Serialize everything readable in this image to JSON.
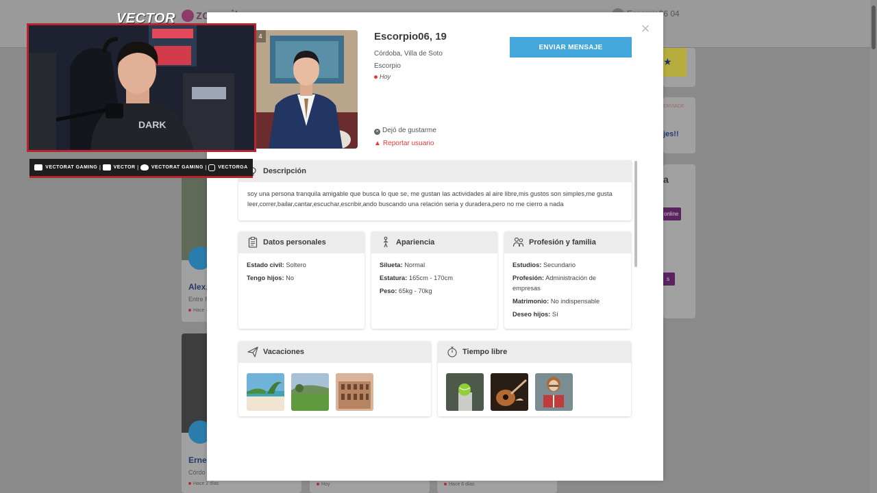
{
  "background": {
    "header_logo": "zonacitas",
    "user_label": "Escorpio06 04",
    "cards": [
      {
        "name": "Alex,",
        "location": "Entre R",
        "status": "Hace ·"
      },
      {
        "name": "Ernes",
        "location": "Córdo",
        "status": "Hace 2 días"
      }
    ],
    "bottom_statuses": [
      "Hoy",
      "Hace 6 días"
    ],
    "right_link": "jes!!",
    "right_small": "ENVIADE",
    "right_letter": "a",
    "online_label": "online",
    "s_label": "s"
  },
  "overlay": {
    "brand": "VECTOR",
    "social": [
      {
        "icon": "youtube-icon",
        "label": "VECTORAT GAMING"
      },
      {
        "icon": "twitch-icon",
        "label": "VECTOR"
      },
      {
        "icon": "twitter-icon",
        "label": "VECTORAT GAMING"
      },
      {
        "icon": "instagram-icon",
        "label": "VECTORGA"
      }
    ]
  },
  "profile": {
    "photo_count": "4",
    "name": "Escorpio06, 19",
    "location": "Córdoba, Villa de Soto",
    "sign": "Escorpio",
    "last_online": "Hoy",
    "send_message": "ENVIAR MENSAJE",
    "unlike": "Dejó de gustarme",
    "report": "Reportar usuario",
    "close_symbol": "×"
  },
  "description": {
    "title": "Descripción",
    "text": "soy una persona tranquila amigable que busca lo que se, me gustan las actividades al aire libre,mis gustos son simples,me gusta leer,correr,bailar,cantar,escuchar,escribir,ando buscando una relación seria y duradera,pero no me cierro a nada"
  },
  "personal": {
    "title": "Datos personales",
    "rows": [
      {
        "label": "Estado civil:",
        "value": "Soltero"
      },
      {
        "label": "Tengo hijos:",
        "value": "No"
      }
    ]
  },
  "appearance": {
    "title": "Apariencia",
    "rows": [
      {
        "label": "Silueta:",
        "value": "Normal"
      },
      {
        "label": "Estatura:",
        "value": "165cm - 170cm"
      },
      {
        "label": "Peso:",
        "value": "65kg - 70kg"
      }
    ]
  },
  "profession": {
    "title": "Profesión y familia",
    "rows": [
      {
        "label": "Estudios:",
        "value": "Secundario"
      },
      {
        "label": "Profesión:",
        "value": "Administración de empresas"
      },
      {
        "label": "Matrimonio:",
        "value": "No indispensable"
      },
      {
        "label": "Deseo hijos:",
        "value": "Sí"
      }
    ]
  },
  "vacations": {
    "title": "Vacaciones",
    "images": [
      "beach-photo",
      "countryside-photo",
      "colosseum-photo"
    ]
  },
  "freetime": {
    "title": "Tiempo libre",
    "images": [
      "tennis-ball-photo",
      "guitar-photo",
      "reading-photo"
    ]
  },
  "colors": {
    "accent": "#43a7dc",
    "report": "#e03a3a",
    "overlay_red": "#b9232e"
  }
}
